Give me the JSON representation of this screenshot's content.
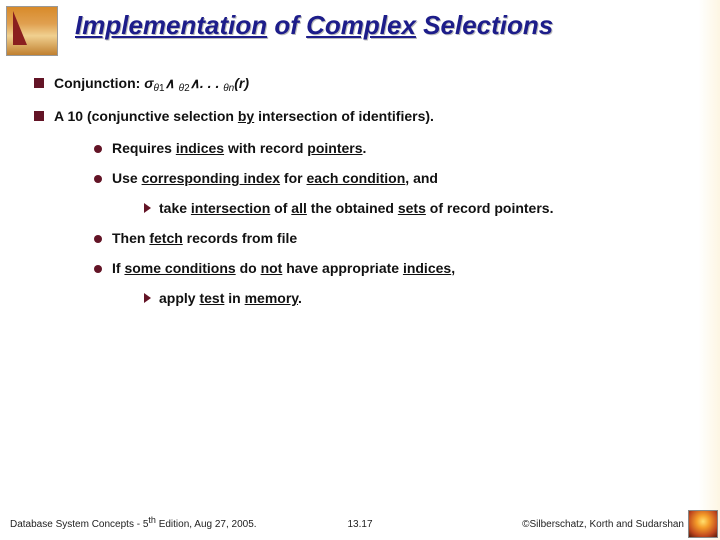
{
  "title": {
    "w1": "Implementation",
    "w2": " of ",
    "w3": "Complex",
    "w4": " Selections"
  },
  "bullets": {
    "conj_label": "Conjunction: ",
    "conj_sigma": "σ",
    "conj_theta": "θ",
    "conj_and": "∧",
    "conj_dots": ". . . ",
    "conj_r": "(r)",
    "sub1": "1",
    "sub2": "2",
    "subn": "n",
    "a10": "A 10 (conjunctive selection ",
    "a10_by": "by",
    "a10_rest": " intersection of identifiers).",
    "req1": "Requires ",
    "req2": "indices",
    "req3": " with record ",
    "req4": "pointers",
    "req5": ".",
    "use1": "Use ",
    "use2": "corresponding index",
    "use3": " for ",
    "use4": "each condition",
    "use5": ", and",
    "take1": "take ",
    "take2": "intersection",
    "take3": " of ",
    "take4": "all",
    "take5": " the obtained ",
    "take6": "sets",
    "take7": " of record pointers.",
    "then1": "Then ",
    "then2": "fetch",
    "then3": " records from file",
    "if1": "If ",
    "if2": "some conditions",
    "if3": " do ",
    "if4": "not",
    "if5": " have appropriate ",
    "if6": "indices",
    "if7": ",",
    "apply1": "apply ",
    "apply2": "test",
    "apply3": " in ",
    "apply4": "memory",
    "apply5": "."
  },
  "footer": {
    "left1": "Database System Concepts - 5",
    "left_sup": "th",
    "left2": " Edition, Aug 27,  2005.",
    "center": "13.17",
    "right": "©Silberschatz, Korth and Sudarshan"
  }
}
